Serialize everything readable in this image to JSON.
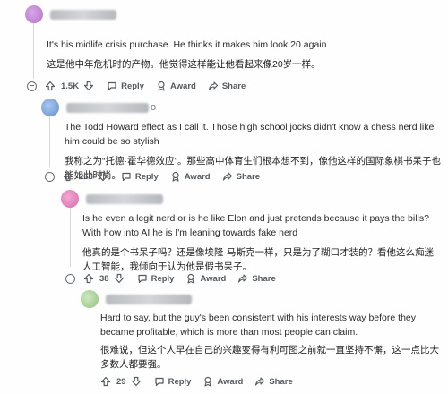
{
  "comments": [
    {
      "id": "c1",
      "suffix": "",
      "text_en": "It's his midlife crisis purchase. He thinks it makes him look 20 again.",
      "text_cn": "这是他中年危机时的产物。他觉得这样能让他看起来像20岁一样。",
      "votes": "1.5K",
      "reply_label": "Reply",
      "award_label": "Award",
      "share_label": "Share",
      "more_label": "···"
    },
    {
      "id": "c2",
      "suffix": "o",
      "text_en": "The Todd Howard effect as I call it. Those high school jocks didn't know a chess nerd like him could be so stylish",
      "text_cn": "我称之为“托德·霍华德效应”。那些高中体育生们根本想不到，像他这样的国际象棋书呆子也能如此时尚。",
      "votes": "263",
      "reply_label": "Reply",
      "award_label": "Award",
      "share_label": "Share",
      "more_label": "···"
    },
    {
      "id": "c3",
      "suffix": "",
      "text_en": "Is he even a legit nerd or is he like Elon and just pretends because it pays the bills? With how into AI he is I'm leaning towards fake nerd",
      "text_cn": "他真的是个书呆子吗？还是像埃隆·马斯克一样，只是为了糊口才装的？看他这么痴迷人工智能，我倾向于认为他是假书呆子。",
      "votes": "38",
      "reply_label": "Reply",
      "award_label": "Award",
      "share_label": "Share",
      "more_label": "···"
    },
    {
      "id": "c4",
      "suffix": "",
      "text_en": "Hard to say, but the guy's been consistent with his interests way before they became profitable, which is more than most people can claim.",
      "text_cn": "很难说，但这个人早在自己的兴趣变得有利可图之前就一直坚持不懈，这一点比大多数人都要强。",
      "votes": "29",
      "reply_label": "Reply",
      "award_label": "Award",
      "share_label": "Share",
      "more_label": "···"
    }
  ]
}
